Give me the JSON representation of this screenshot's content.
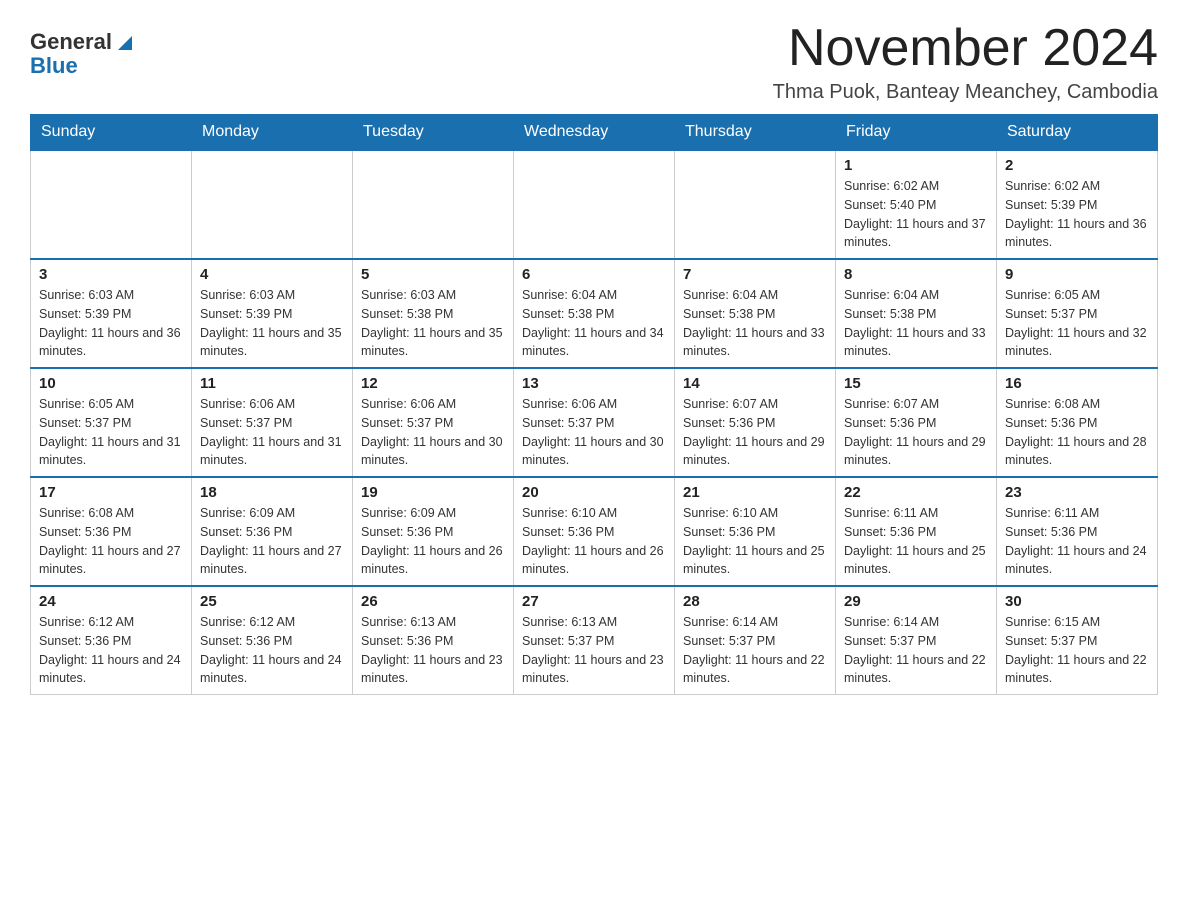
{
  "header": {
    "logo_general": "General",
    "logo_blue": "Blue",
    "month_title": "November 2024",
    "location": "Thma Puok, Banteay Meanchey, Cambodia"
  },
  "days_of_week": [
    "Sunday",
    "Monday",
    "Tuesday",
    "Wednesday",
    "Thursday",
    "Friday",
    "Saturday"
  ],
  "weeks": [
    [
      {
        "day": "",
        "info": ""
      },
      {
        "day": "",
        "info": ""
      },
      {
        "day": "",
        "info": ""
      },
      {
        "day": "",
        "info": ""
      },
      {
        "day": "",
        "info": ""
      },
      {
        "day": "1",
        "info": "Sunrise: 6:02 AM\nSunset: 5:40 PM\nDaylight: 11 hours and 37 minutes."
      },
      {
        "day": "2",
        "info": "Sunrise: 6:02 AM\nSunset: 5:39 PM\nDaylight: 11 hours and 36 minutes."
      }
    ],
    [
      {
        "day": "3",
        "info": "Sunrise: 6:03 AM\nSunset: 5:39 PM\nDaylight: 11 hours and 36 minutes."
      },
      {
        "day": "4",
        "info": "Sunrise: 6:03 AM\nSunset: 5:39 PM\nDaylight: 11 hours and 35 minutes."
      },
      {
        "day": "5",
        "info": "Sunrise: 6:03 AM\nSunset: 5:38 PM\nDaylight: 11 hours and 35 minutes."
      },
      {
        "day": "6",
        "info": "Sunrise: 6:04 AM\nSunset: 5:38 PM\nDaylight: 11 hours and 34 minutes."
      },
      {
        "day": "7",
        "info": "Sunrise: 6:04 AM\nSunset: 5:38 PM\nDaylight: 11 hours and 33 minutes."
      },
      {
        "day": "8",
        "info": "Sunrise: 6:04 AM\nSunset: 5:38 PM\nDaylight: 11 hours and 33 minutes."
      },
      {
        "day": "9",
        "info": "Sunrise: 6:05 AM\nSunset: 5:37 PM\nDaylight: 11 hours and 32 minutes."
      }
    ],
    [
      {
        "day": "10",
        "info": "Sunrise: 6:05 AM\nSunset: 5:37 PM\nDaylight: 11 hours and 31 minutes."
      },
      {
        "day": "11",
        "info": "Sunrise: 6:06 AM\nSunset: 5:37 PM\nDaylight: 11 hours and 31 minutes."
      },
      {
        "day": "12",
        "info": "Sunrise: 6:06 AM\nSunset: 5:37 PM\nDaylight: 11 hours and 30 minutes."
      },
      {
        "day": "13",
        "info": "Sunrise: 6:06 AM\nSunset: 5:37 PM\nDaylight: 11 hours and 30 minutes."
      },
      {
        "day": "14",
        "info": "Sunrise: 6:07 AM\nSunset: 5:36 PM\nDaylight: 11 hours and 29 minutes."
      },
      {
        "day": "15",
        "info": "Sunrise: 6:07 AM\nSunset: 5:36 PM\nDaylight: 11 hours and 29 minutes."
      },
      {
        "day": "16",
        "info": "Sunrise: 6:08 AM\nSunset: 5:36 PM\nDaylight: 11 hours and 28 minutes."
      }
    ],
    [
      {
        "day": "17",
        "info": "Sunrise: 6:08 AM\nSunset: 5:36 PM\nDaylight: 11 hours and 27 minutes."
      },
      {
        "day": "18",
        "info": "Sunrise: 6:09 AM\nSunset: 5:36 PM\nDaylight: 11 hours and 27 minutes."
      },
      {
        "day": "19",
        "info": "Sunrise: 6:09 AM\nSunset: 5:36 PM\nDaylight: 11 hours and 26 minutes."
      },
      {
        "day": "20",
        "info": "Sunrise: 6:10 AM\nSunset: 5:36 PM\nDaylight: 11 hours and 26 minutes."
      },
      {
        "day": "21",
        "info": "Sunrise: 6:10 AM\nSunset: 5:36 PM\nDaylight: 11 hours and 25 minutes."
      },
      {
        "day": "22",
        "info": "Sunrise: 6:11 AM\nSunset: 5:36 PM\nDaylight: 11 hours and 25 minutes."
      },
      {
        "day": "23",
        "info": "Sunrise: 6:11 AM\nSunset: 5:36 PM\nDaylight: 11 hours and 24 minutes."
      }
    ],
    [
      {
        "day": "24",
        "info": "Sunrise: 6:12 AM\nSunset: 5:36 PM\nDaylight: 11 hours and 24 minutes."
      },
      {
        "day": "25",
        "info": "Sunrise: 6:12 AM\nSunset: 5:36 PM\nDaylight: 11 hours and 24 minutes."
      },
      {
        "day": "26",
        "info": "Sunrise: 6:13 AM\nSunset: 5:36 PM\nDaylight: 11 hours and 23 minutes."
      },
      {
        "day": "27",
        "info": "Sunrise: 6:13 AM\nSunset: 5:37 PM\nDaylight: 11 hours and 23 minutes."
      },
      {
        "day": "28",
        "info": "Sunrise: 6:14 AM\nSunset: 5:37 PM\nDaylight: 11 hours and 22 minutes."
      },
      {
        "day": "29",
        "info": "Sunrise: 6:14 AM\nSunset: 5:37 PM\nDaylight: 11 hours and 22 minutes."
      },
      {
        "day": "30",
        "info": "Sunrise: 6:15 AM\nSunset: 5:37 PM\nDaylight: 11 hours and 22 minutes."
      }
    ]
  ]
}
